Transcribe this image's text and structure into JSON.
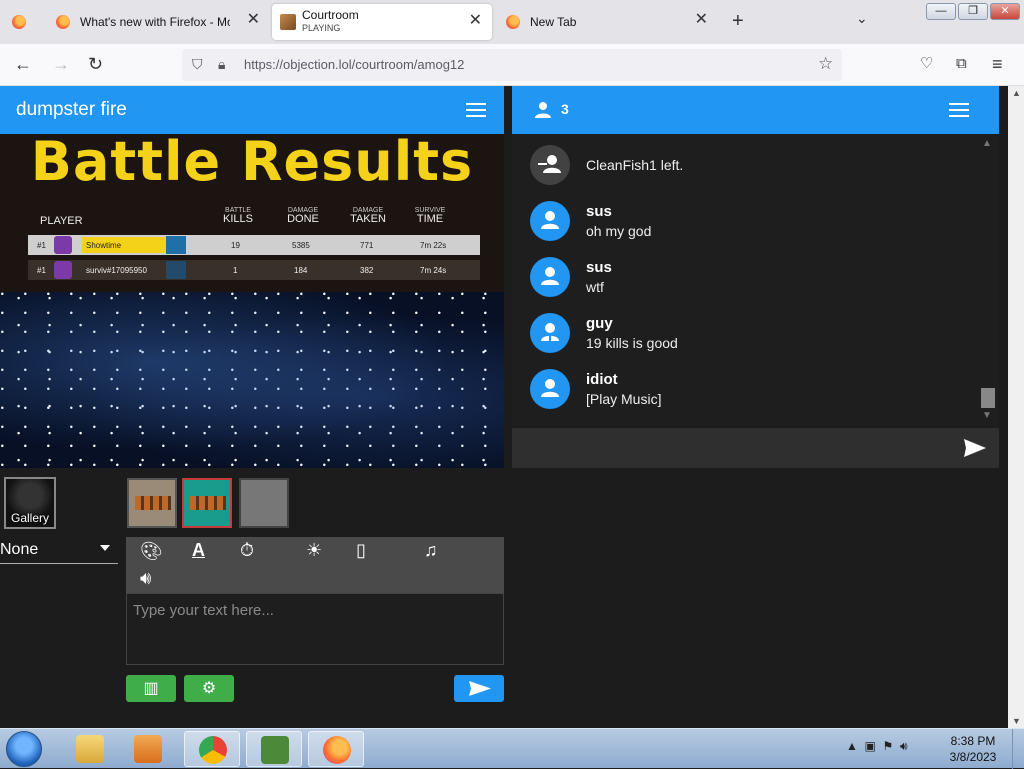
{
  "browser": {
    "tabs": [
      {
        "title": "What's new with Firefox - More",
        "close": "✕"
      },
      {
        "title": "Courtroom",
        "subtitle": "PLAYING",
        "close": "✕"
      },
      {
        "title": "New Tab",
        "close": "✕"
      }
    ],
    "new_tab": "+",
    "list_all_tabs": "⌄",
    "url": "https://objection.lol/courtroom/amog12",
    "window_controls": {
      "minimize": "—",
      "maximize": "❐",
      "close": "✕"
    }
  },
  "app": {
    "room_title": "dumpster fire",
    "scene": {
      "heading": "Battle Results",
      "player_header": "PLAYER",
      "columns": [
        {
          "top": "BATTLE",
          "main": "KILLS"
        },
        {
          "top": "DAMAGE",
          "main": "DONE"
        },
        {
          "top": "DAMAGE",
          "main": "TAKEN"
        },
        {
          "top": "SURVIVE",
          "main": "TIME"
        }
      ],
      "rows": [
        {
          "rank": "#1",
          "name": "Showtime",
          "kills": "19",
          "done": "5385",
          "taken": "771",
          "time": "7m 22s"
        },
        {
          "rank": "#1",
          "name": "surviv#17095950",
          "kills": "1",
          "done": "184",
          "taken": "382",
          "time": "7m 24s"
        }
      ]
    },
    "gallery_label": "Gallery",
    "pose_select": "None",
    "textarea_placeholder": "Type your text here..."
  },
  "chat": {
    "user_count": "3",
    "messages": [
      {
        "type": "system",
        "text": "CleanFish1 left."
      },
      {
        "type": "user",
        "name": "sus",
        "text": "oh my god"
      },
      {
        "type": "user",
        "name": "sus",
        "text": "wtf"
      },
      {
        "type": "user",
        "name": "guy",
        "text": "19 kills is good"
      },
      {
        "type": "user",
        "name": "idiot",
        "text": "[Play Music]"
      }
    ]
  },
  "taskbar": {
    "time": "8:38 PM",
    "date": "3/8/2023"
  },
  "colors": {
    "accent": "#2196f3",
    "green_button": "#3fae49",
    "dark_bg": "#1c1c1c"
  }
}
